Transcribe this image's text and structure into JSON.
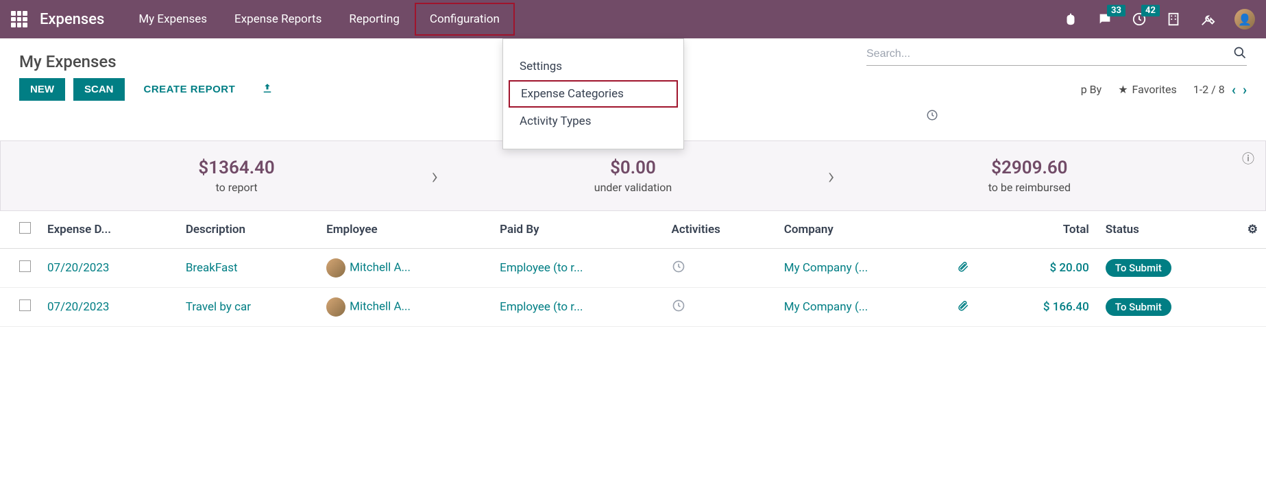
{
  "navbar": {
    "brand": "Expenses",
    "items": [
      "My Expenses",
      "Expense Reports",
      "Reporting",
      "Configuration"
    ],
    "badges": {
      "messages": "33",
      "activities": "42"
    }
  },
  "dropdown": {
    "items": [
      "Settings",
      "Expense Categories",
      "Activity Types"
    ]
  },
  "breadcrumb": "My Expenses",
  "buttons": {
    "new": "NEW",
    "scan": "SCAN",
    "create_report": "CREATE REPORT"
  },
  "search": {
    "placeholder": "Search..."
  },
  "filters": {
    "group_by": "p By",
    "favorites": "Favorites"
  },
  "pager": {
    "range": "1-2 / 8"
  },
  "summary": [
    {
      "amount": "$1364.40",
      "label": "to report"
    },
    {
      "amount": "$0.00",
      "label": "under validation"
    },
    {
      "amount": "$2909.60",
      "label": "to be reimbursed"
    }
  ],
  "table": {
    "headers": {
      "date": "Expense D...",
      "description": "Description",
      "employee": "Employee",
      "paid_by": "Paid By",
      "activities": "Activities",
      "company": "Company",
      "total": "Total",
      "status": "Status"
    },
    "rows": [
      {
        "date": "07/20/2023",
        "description": "BreakFast",
        "employee": "Mitchell A...",
        "paid_by": "Employee (to r...",
        "company": "My Company (...",
        "total": "$ 20.00",
        "status": "To Submit"
      },
      {
        "date": "07/20/2023",
        "description": "Travel by car",
        "employee": "Mitchell A...",
        "paid_by": "Employee (to r...",
        "company": "My Company (...",
        "total": "$ 166.40",
        "status": "To Submit"
      }
    ]
  }
}
